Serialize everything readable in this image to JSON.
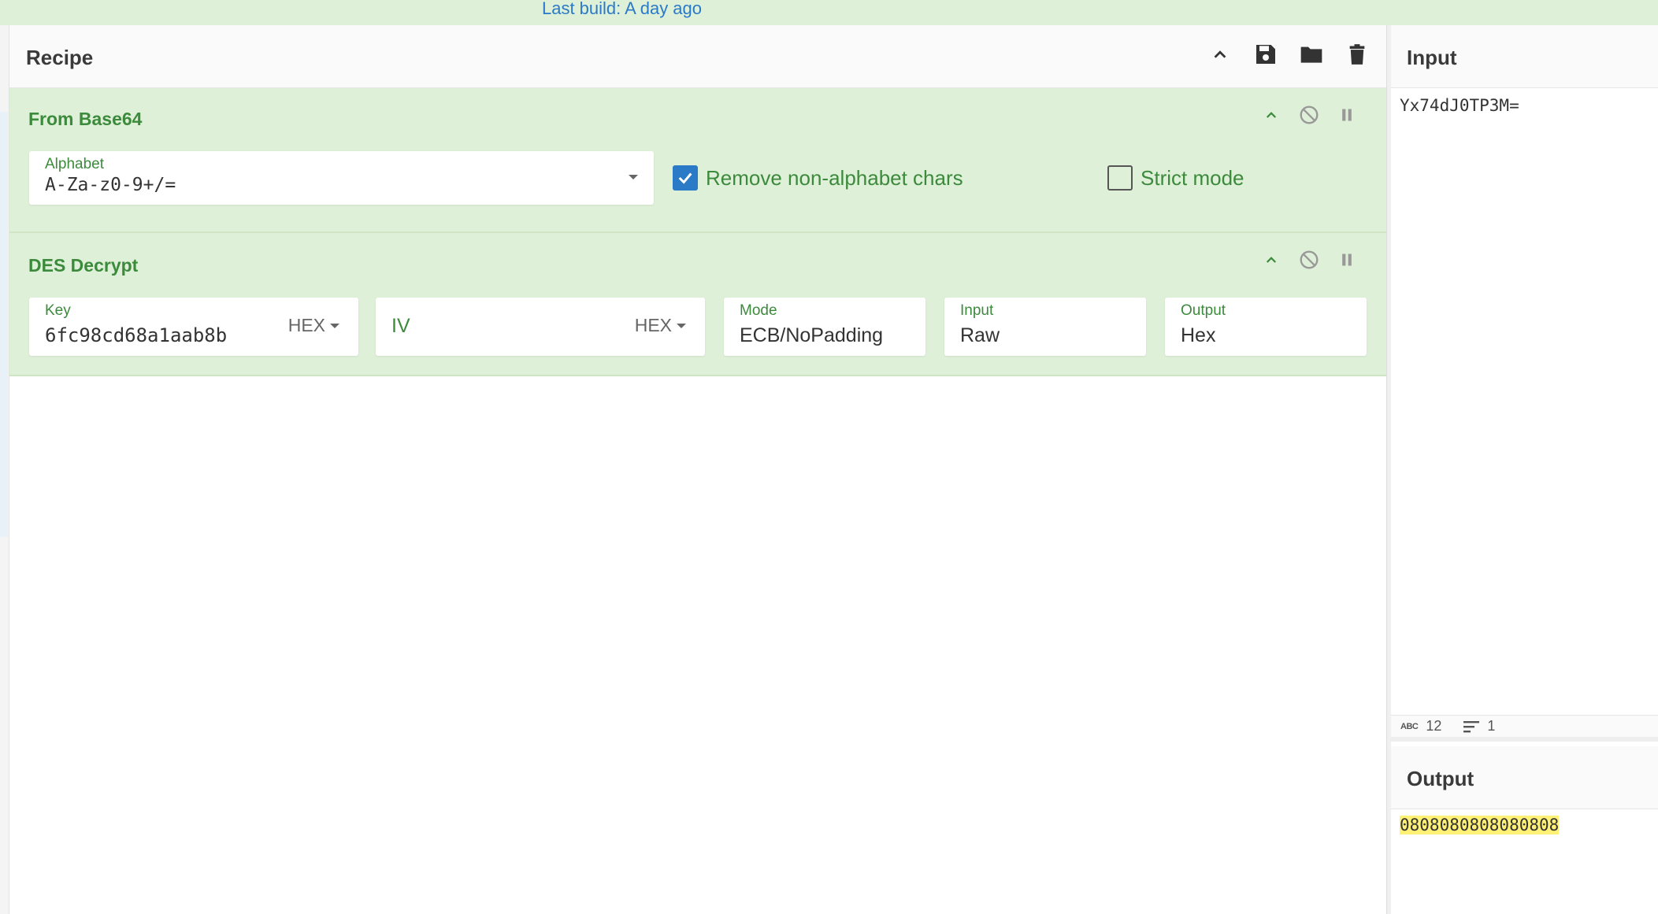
{
  "topbar": {
    "last_build": "Last build: A day ago"
  },
  "recipe": {
    "title": "Recipe",
    "tools": [
      "chevron-up-icon",
      "save-icon",
      "folder-icon",
      "trash-icon"
    ]
  },
  "from_base64": {
    "title": "From Base64",
    "alphabet_label": "Alphabet",
    "alphabet_value": "A-Za-z0-9+/=",
    "remove_label": "Remove non-alphabet chars",
    "remove_checked": true,
    "strict_label": "Strict mode",
    "strict_checked": false
  },
  "des_decrypt": {
    "title": "DES Decrypt",
    "key_label": "Key",
    "key_value": "6fc98cd68a1aab8b",
    "key_format": "HEX",
    "iv_placeholder": "IV",
    "iv_format": "HEX",
    "mode_label": "Mode",
    "mode_value": "ECB/NoPadding",
    "input_label": "Input",
    "input_value": "Raw",
    "output_label": "Output",
    "output_value": "Hex"
  },
  "input_panel": {
    "title": "Input",
    "text": "Yx74dJ0TP3M=",
    "char_count": "12",
    "line_count": "1"
  },
  "output_panel": {
    "title": "Output",
    "text": "0808080808080808"
  },
  "colors": {
    "op_bg": "#dff0d8",
    "op_text": "#3c8a3c",
    "accent": "#2a7ac8",
    "highlight": "#fff176"
  }
}
